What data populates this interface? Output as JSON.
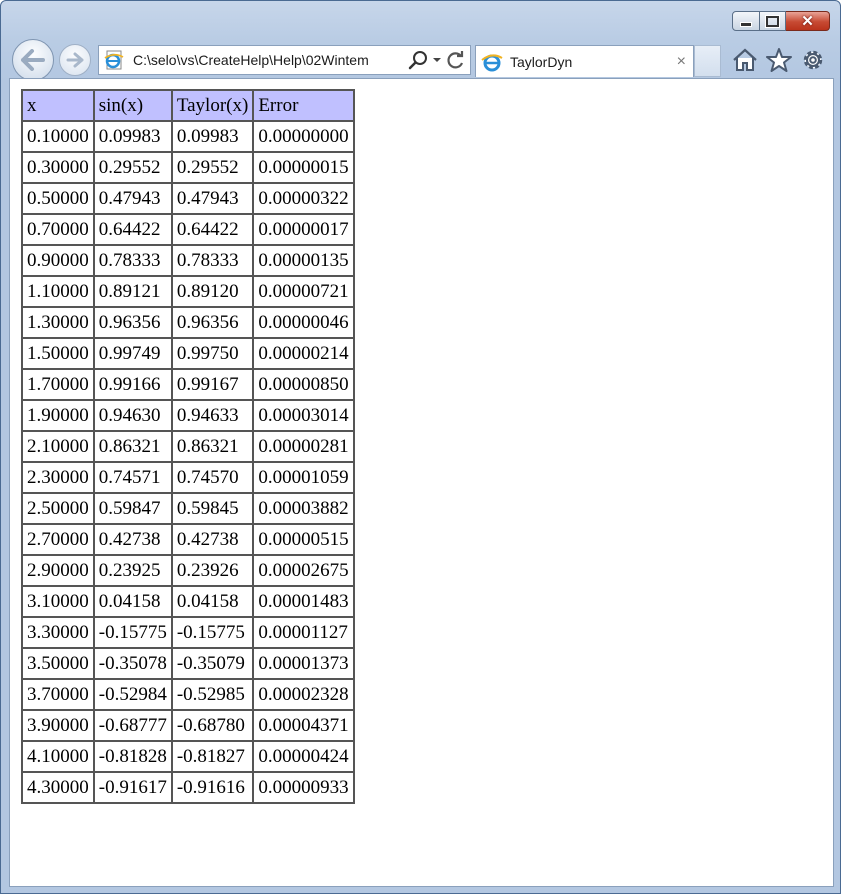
{
  "window": {
    "address_url": "C:\\selo\\vs\\CreateHelp\\Help\\02Wintem",
    "tab_title": "TaylorDyn",
    "tab_close": "×",
    "caption_close": "✕"
  },
  "table": {
    "headers": [
      "x",
      "sin(x)",
      "Taylor(x)",
      "Error"
    ],
    "rows": [
      [
        "0.10000",
        "0.09983",
        "0.09983",
        "0.00000000"
      ],
      [
        "0.30000",
        "0.29552",
        "0.29552",
        "0.00000015"
      ],
      [
        "0.50000",
        "0.47943",
        "0.47943",
        "0.00000322"
      ],
      [
        "0.70000",
        "0.64422",
        "0.64422",
        "0.00000017"
      ],
      [
        "0.90000",
        "0.78333",
        "0.78333",
        "0.00000135"
      ],
      [
        "1.10000",
        "0.89121",
        "0.89120",
        "0.00000721"
      ],
      [
        "1.30000",
        "0.96356",
        "0.96356",
        "0.00000046"
      ],
      [
        "1.50000",
        "0.99749",
        "0.99750",
        "0.00000214"
      ],
      [
        "1.70000",
        "0.99166",
        "0.99167",
        "0.00000850"
      ],
      [
        "1.90000",
        "0.94630",
        "0.94633",
        "0.00003014"
      ],
      [
        "2.10000",
        "0.86321",
        "0.86321",
        "0.00000281"
      ],
      [
        "2.30000",
        "0.74571",
        "0.74570",
        "0.00001059"
      ],
      [
        "2.50000",
        "0.59847",
        "0.59845",
        "0.00003882"
      ],
      [
        "2.70000",
        "0.42738",
        "0.42738",
        "0.00000515"
      ],
      [
        "2.90000",
        "0.23925",
        "0.23926",
        "0.00002675"
      ],
      [
        "3.10000",
        "0.04158",
        "0.04158",
        "0.00001483"
      ],
      [
        "3.30000",
        "-0.15775",
        "-0.15775",
        "0.00001127"
      ],
      [
        "3.50000",
        "-0.35078",
        "-0.35079",
        "0.00001373"
      ],
      [
        "3.70000",
        "-0.52984",
        "-0.52985",
        "0.00002328"
      ],
      [
        "3.90000",
        "-0.68777",
        "-0.68780",
        "0.00004371"
      ],
      [
        "4.10000",
        "-0.81828",
        "-0.81827",
        "0.00000424"
      ],
      [
        "4.30000",
        "-0.91617",
        "-0.91616",
        "0.00000933"
      ]
    ]
  },
  "icons": {
    "back": "back-arrow-icon",
    "forward": "forward-arrow-icon",
    "page": "ie-page-icon",
    "search": "search-icon",
    "dropdown": "dropdown-arrow-icon",
    "refresh": "refresh-icon",
    "home": "home-icon",
    "favorites": "star-icon",
    "tools": "gear-icon"
  },
  "colors": {
    "header_bg": "#c0c0ff",
    "border": "#555555",
    "close_button": "#c74a33"
  }
}
